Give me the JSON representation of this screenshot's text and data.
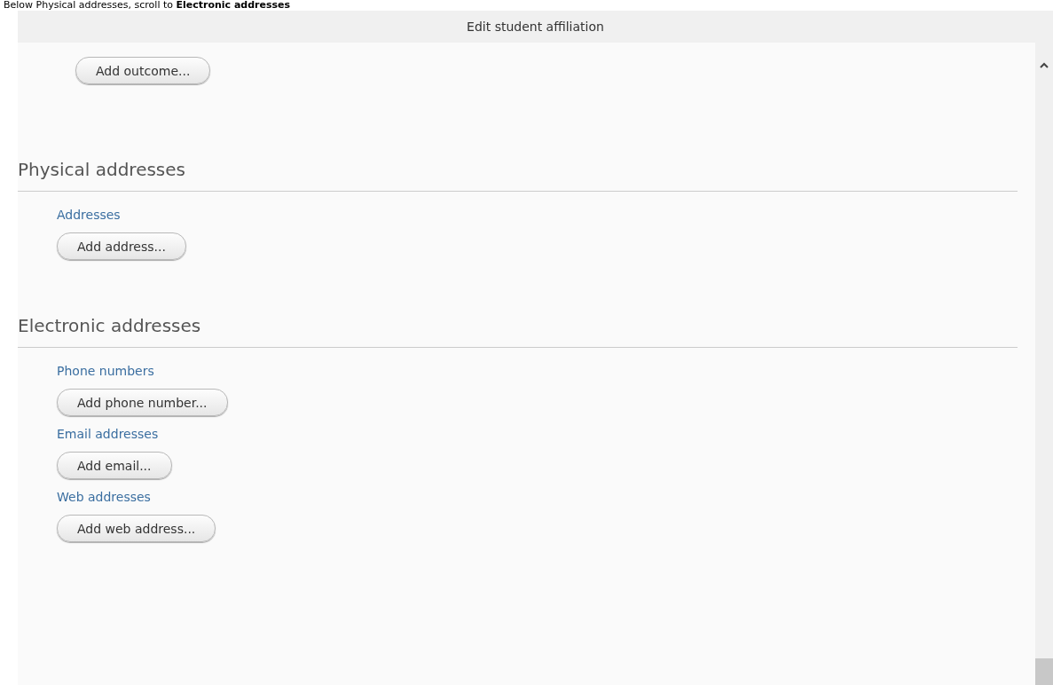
{
  "instruction": "Below Physical addresses, scroll to **Electronic addresses**",
  "dialog": {
    "title": "Edit student affiliation"
  },
  "top_button": "Add outcome...",
  "sections": [
    {
      "heading": "Physical addresses",
      "groups": [
        {
          "label": "Addresses",
          "button": "Add address..."
        }
      ]
    },
    {
      "heading": "Electronic addresses",
      "groups": [
        {
          "label": "Phone numbers",
          "button": "Add phone number..."
        },
        {
          "label": "Email addresses",
          "button": "Add email..."
        },
        {
          "label": "Web addresses",
          "button": "Add web address..."
        }
      ]
    }
  ]
}
